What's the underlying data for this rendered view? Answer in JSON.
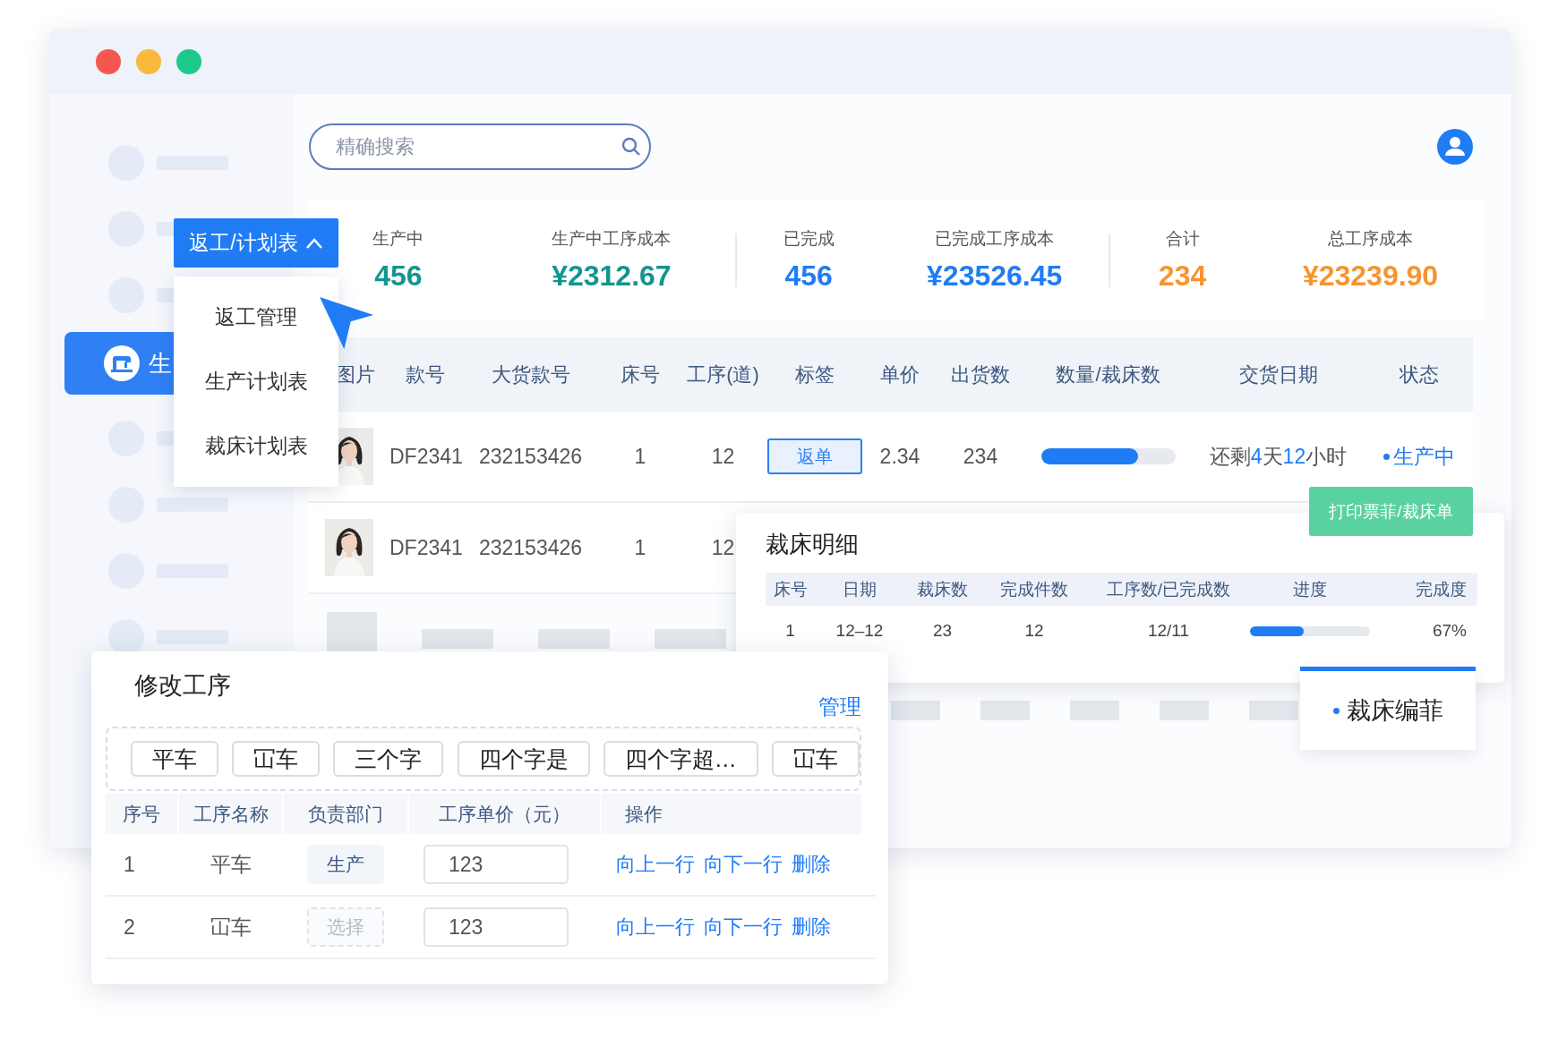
{
  "search": {
    "placeholder": "精确搜索"
  },
  "sidebar": {
    "active_item": {
      "label": "生"
    },
    "menu_button": {
      "label": "返工/计划表",
      "expanded": true
    },
    "menu_items": [
      {
        "label": "返工管理"
      },
      {
        "label": "生产计划表"
      },
      {
        "label": "裁床计划表"
      }
    ]
  },
  "stats": [
    {
      "label": "生产中",
      "value": "456",
      "color": "#13958e"
    },
    {
      "label": "生产中工序成本",
      "value": "¥2312.67",
      "color": "#13958e"
    },
    {
      "label": "已完成",
      "value": "456",
      "color": "#1f7cf5"
    },
    {
      "label": "已完成工序成本",
      "value": "¥23526.45",
      "color": "#1f7cf5"
    },
    {
      "label": "合计",
      "value": "234",
      "color": "#f7942f"
    },
    {
      "label": "总工序成本",
      "value": "¥23239.90",
      "color": "#f7942f"
    }
  ],
  "table": {
    "columns": [
      "图片",
      "款号",
      "大货款号",
      "床号",
      "工序(道)",
      "标签",
      "单价",
      "出货数",
      "数量/裁床数",
      "交货日期",
      "状态"
    ],
    "rows": [
      {
        "image": {
          "kind": "picture"
        },
        "style_no": "DF2341",
        "bulk_no": "232153426",
        "bed": "1",
        "process": "12",
        "tag": "返单",
        "price": "2.34",
        "shipped": "234",
        "level": 0.72,
        "due": [
          {
            "text": "还剩",
            "highlight": false
          },
          {
            "text": "4",
            "highlight": true
          },
          {
            "text": "天",
            "highlight": false
          },
          {
            "text": "12",
            "highlight": true
          },
          {
            "text": "小时",
            "highlight": false
          }
        ],
        "status": {
          "label": "生产中",
          "color": "#1f7cf5"
        }
      },
      {
        "image": {
          "kind": "picture"
        },
        "style_no": "DF2341",
        "bulk_no": "232153426",
        "bed": "1",
        "process": "12"
      }
    ]
  },
  "cutting_detail": {
    "title": "裁床明细",
    "print_button": "打印票菲/裁床单",
    "columns": [
      "床号",
      "日期",
      "裁床数",
      "完成件数",
      "工序数/已完成数",
      "进度",
      "完成度"
    ],
    "rows": [
      {
        "bed": "1",
        "date": "12–12",
        "cut": "23",
        "done": "12",
        "ratio": "12/11",
        "level": 0.45,
        "percent": "67%"
      }
    ]
  },
  "side_tab": {
    "label": "裁床编菲",
    "selected": true
  },
  "edit_panel": {
    "title": "修改工序",
    "manage": "管理",
    "chips": [
      "平车",
      "冚车",
      "三个字",
      "四个字是",
      "四个字超…",
      "冚车"
    ],
    "columns": [
      "序号",
      "工序名称",
      "负责部门",
      "工序单价（元）",
      "操作"
    ],
    "rows": [
      {
        "index": "1",
        "name": "平车",
        "dept": {
          "value": "生产"
        },
        "price": "123",
        "actions": [
          "向上一行",
          "向下一行",
          "删除"
        ]
      },
      {
        "index": "2",
        "name": "冚车",
        "dept": {
          "placeholder": "选择"
        },
        "price": "123",
        "actions": [
          "向上一行",
          "向下一行",
          "删除"
        ]
      }
    ]
  }
}
